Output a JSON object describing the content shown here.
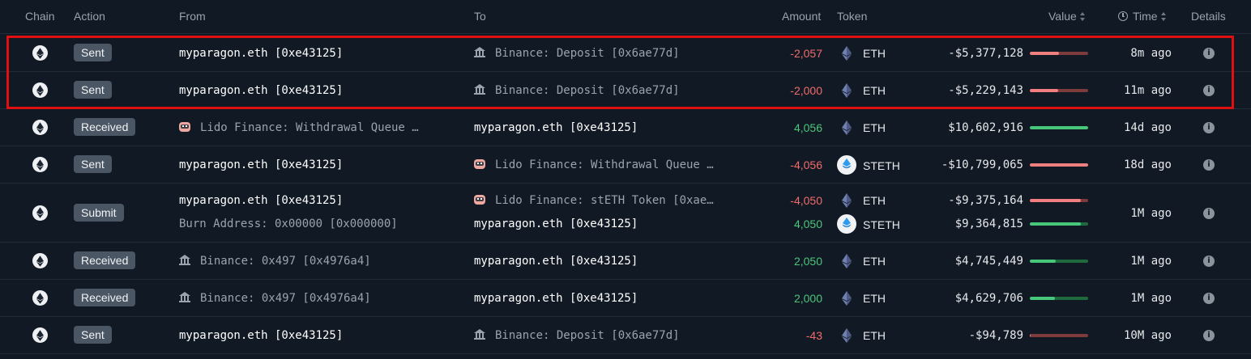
{
  "header": {
    "chain": "Chain",
    "action": "Action",
    "from": "From",
    "to": "To",
    "amount": "Amount",
    "token": "Token",
    "value": "Value",
    "time": "Time",
    "details": "Details"
  },
  "colors": {
    "negative": "#f26b6b",
    "positive": "#4cc47a",
    "highlight": "#e01010",
    "badge": "#4a5664"
  },
  "rows": [
    {
      "action": "Sent",
      "lines": [
        {
          "from": "myparagon.eth [0xe43125]",
          "from_icon": "none",
          "from_muted": false,
          "to": "Binance: Deposit [0x6ae77d]",
          "to_icon": "bank-icon",
          "to_muted": true,
          "amount": "-2,057",
          "token": "ETH",
          "token_icon": "eth-icon",
          "value": "-$5,377,128",
          "bar_fraction": 0.5
        }
      ],
      "time": "8m ago"
    },
    {
      "action": "Sent",
      "lines": [
        {
          "from": "myparagon.eth [0xe43125]",
          "from_icon": "none",
          "from_muted": false,
          "to": "Binance: Deposit [0x6ae77d]",
          "to_icon": "bank-icon",
          "to_muted": true,
          "amount": "-2,000",
          "token": "ETH",
          "token_icon": "eth-icon",
          "value": "-$5,229,143",
          "bar_fraction": 0.48
        }
      ],
      "time": "11m ago"
    },
    {
      "action": "Received",
      "lines": [
        {
          "from": "Lido Finance: Withdrawal Queue …",
          "from_icon": "lido-icon",
          "from_muted": true,
          "to": "myparagon.eth [0xe43125]",
          "to_icon": "none",
          "to_muted": false,
          "amount": "4,056",
          "token": "ETH",
          "token_icon": "eth-icon",
          "value": "$10,602,916",
          "bar_fraction": 1.0
        }
      ],
      "time": "14d ago"
    },
    {
      "action": "Sent",
      "lines": [
        {
          "from": "myparagon.eth [0xe43125]",
          "from_icon": "none",
          "from_muted": false,
          "to": "Lido Finance: Withdrawal Queue …",
          "to_icon": "lido-icon",
          "to_muted": true,
          "amount": "-4,056",
          "token": "STETH",
          "token_icon": "steth-icon",
          "value": "-$10,799,065",
          "bar_fraction": 1.0
        }
      ],
      "time": "18d ago"
    },
    {
      "action": "Submit",
      "lines": [
        {
          "from": "myparagon.eth [0xe43125]",
          "from_icon": "none",
          "from_muted": false,
          "to": "Lido Finance: stETH Token [0xae…",
          "to_icon": "lido-icon",
          "to_muted": true,
          "amount": "-4,050",
          "token": "ETH",
          "token_icon": "eth-icon",
          "value": "-$9,375,164",
          "bar_fraction": 0.88
        },
        {
          "from": "Burn Address: 0x00000 [0x000000]",
          "from_icon": "none",
          "from_muted": true,
          "to": "myparagon.eth [0xe43125]",
          "to_icon": "none",
          "to_muted": false,
          "amount": "4,050",
          "token": "STETH",
          "token_icon": "steth-icon",
          "value": "$9,364,815",
          "bar_fraction": 0.88
        }
      ],
      "time": "1M ago"
    },
    {
      "action": "Received",
      "lines": [
        {
          "from": "Binance: 0x497 [0x4976a4]",
          "from_icon": "bank-icon",
          "from_muted": true,
          "to": "myparagon.eth [0xe43125]",
          "to_icon": "none",
          "to_muted": false,
          "amount": "2,050",
          "token": "ETH",
          "token_icon": "eth-icon",
          "value": "$4,745,449",
          "bar_fraction": 0.44
        }
      ],
      "time": "1M ago"
    },
    {
      "action": "Received",
      "lines": [
        {
          "from": "Binance: 0x497 [0x4976a4]",
          "from_icon": "bank-icon",
          "from_muted": true,
          "to": "myparagon.eth [0xe43125]",
          "to_icon": "none",
          "to_muted": false,
          "amount": "2,000",
          "token": "ETH",
          "token_icon": "eth-icon",
          "value": "$4,629,706",
          "bar_fraction": 0.43
        }
      ],
      "time": "1M ago"
    },
    {
      "action": "Sent",
      "lines": [
        {
          "from": "myparagon.eth [0xe43125]",
          "from_icon": "none",
          "from_muted": false,
          "to": "Binance: Deposit [0x6ae77d]",
          "to_icon": "bank-icon",
          "to_muted": true,
          "amount": "-43",
          "token": "ETH",
          "token_icon": "eth-icon",
          "value": "-$94,789",
          "bar_fraction": 0.01
        }
      ],
      "time": "10M ago"
    }
  ]
}
